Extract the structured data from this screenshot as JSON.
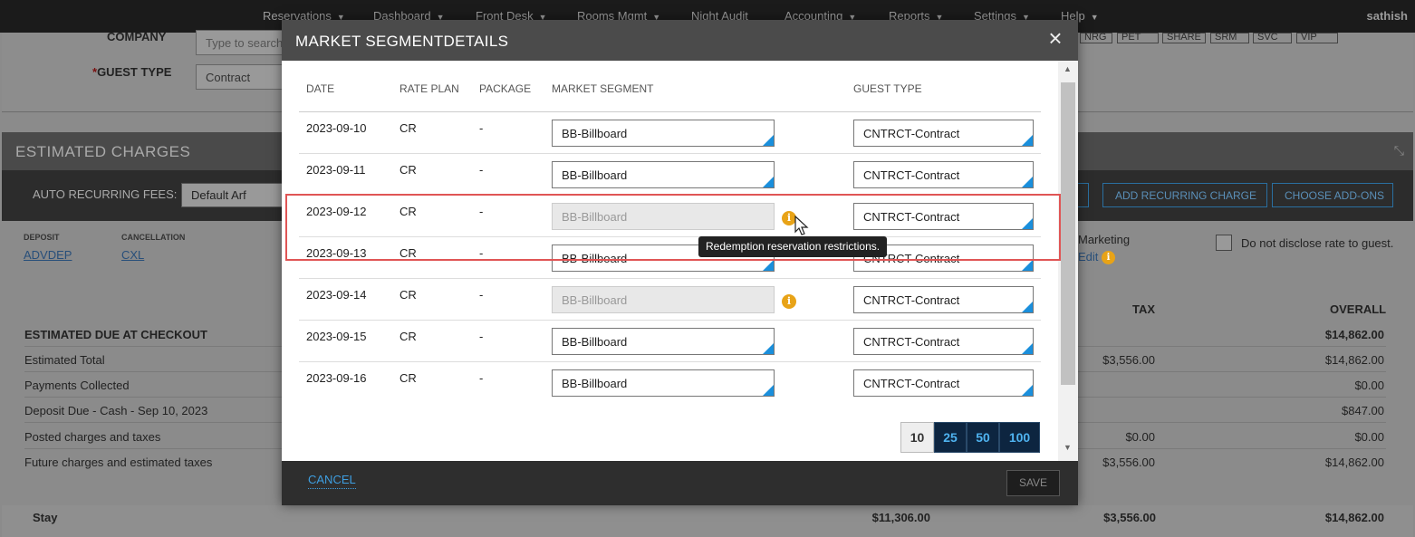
{
  "nav": {
    "items": [
      "Reservations",
      "Dashboard",
      "Front Desk",
      "Rooms Mgmt",
      "Night Audit",
      "Accounting",
      "Reports",
      "Settings",
      "Help"
    ],
    "user": "sathish"
  },
  "background": {
    "company_label": "COMPANY",
    "company_placeholder": "Type to search",
    "guest_type_required": "*",
    "guest_type_label": "GUEST TYPE",
    "guest_type_value": "Contract",
    "tags": [
      "NRG",
      "PET",
      "SHARE",
      "SRM",
      "SVC",
      "VIP"
    ],
    "estimated_charges_title": "ESTIMATED CHARGES",
    "auto_recurring_label": "AUTO RECURRING FEES:",
    "auto_recurring_value": "Default Arf",
    "add_recurring_charge": "ADD RECURRING CHARGE",
    "choose_add_ons": "CHOOSE ADD-ONS",
    "deposit_header": "DEPOSIT",
    "deposit_value": "ADVDEP",
    "cancellation_header": "CANCELLATION",
    "cancellation_value": "CXL",
    "marketing_label": "Marketing",
    "marketing_edit": "Edit",
    "disclose_label": "Do not disclose rate to guest.",
    "col_tax": "TAX",
    "col_overall": "OVERALL",
    "rows": [
      {
        "label": "ESTIMATED DUE AT CHECKOUT",
        "tax": "",
        "overall": "$14,862.00",
        "bold": true
      },
      {
        "label": "Estimated Total",
        "tax": "$3,556.00",
        "overall": "$14,862.00"
      },
      {
        "label": "Payments Collected",
        "tax": "",
        "overall": "$0.00"
      },
      {
        "label": "Deposit Due - Cash - Sep 10, 2023",
        "tax": "",
        "overall": "$847.00"
      },
      {
        "label": "Posted charges and taxes",
        "tax": "$0.00",
        "overall": "$0.00"
      },
      {
        "label": "Future charges and estimated taxes",
        "tax": "$3,556.00",
        "overall": "$14,862.00"
      }
    ],
    "stay": {
      "label": "Stay",
      "amount": "$11,306.00",
      "tax": "$3,556.00",
      "overall": "$14,862.00"
    }
  },
  "modal": {
    "title": "MARKET SEGMENTDETAILS",
    "headers": {
      "date": "DATE",
      "rate_plan": "RATE PLAN",
      "package": "PACKAGE",
      "market_segment": "MARKET SEGMENT",
      "guest_type": "GUEST TYPE"
    },
    "rows": [
      {
        "date": "2023-09-10",
        "rate_plan": "CR",
        "package": "-",
        "market_segment": "BB-Billboard",
        "guest_type": "CNTRCT-Contract",
        "disabled": false
      },
      {
        "date": "2023-09-11",
        "rate_plan": "CR",
        "package": "-",
        "market_segment": "BB-Billboard",
        "guest_type": "CNTRCT-Contract",
        "disabled": false
      },
      {
        "date": "2023-09-12",
        "rate_plan": "CR",
        "package": "-",
        "market_segment": "BB-Billboard",
        "guest_type": "CNTRCT-Contract",
        "disabled": true
      },
      {
        "date": "2023-09-13",
        "rate_plan": "CR",
        "package": "-",
        "market_segment": "BB-Billboard",
        "guest_type": "CNTRCT-Contract",
        "disabled": false
      },
      {
        "date": "2023-09-14",
        "rate_plan": "CR",
        "package": "-",
        "market_segment": "BB-Billboard",
        "guest_type": "CNTRCT-Contract",
        "disabled": true
      },
      {
        "date": "2023-09-15",
        "rate_plan": "CR",
        "package": "-",
        "market_segment": "BB-Billboard",
        "guest_type": "CNTRCT-Contract",
        "disabled": false
      },
      {
        "date": "2023-09-16",
        "rate_plan": "CR",
        "package": "-",
        "market_segment": "BB-Billboard",
        "guest_type": "CNTRCT-Contract",
        "disabled": false
      }
    ],
    "info_glyph": "i",
    "tooltip": "Redemption reservation restrictions.",
    "page_sizes": [
      "10",
      "25",
      "50",
      "100"
    ],
    "active_page_size": "10",
    "cancel_label": "CANCEL",
    "save_label": "SAVE",
    "close_glyph": "×"
  },
  "colors": {
    "accent": "#1a8fdc",
    "highlight": "#e05555",
    "warning": "#e8a317"
  }
}
